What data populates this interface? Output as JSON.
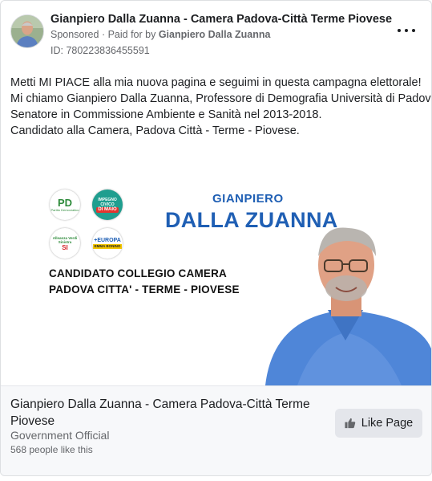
{
  "post": {
    "page_name": "Gianpiero Dalla Zuanna - Camera Padova-Città Terme Piovese",
    "sponsored_label": "Sponsored",
    "paid_for_text": "Paid for by",
    "paid_for_name": "Gianpiero Dalla Zuanna",
    "ad_id": "ID: 780223836455591",
    "more_icon": "more-horizontal-icon",
    "body_lines": [
      "Metti MI PIACE alla mia nuova pagina e seguimi in questa campagna elettorale!",
      "Mi chiamo Gianpiero Dalla Zuanna, Professore di Demografia Università di Padova,",
      "Senatore in Commissione Ambiente e Sanità nel 2013-2018.",
      "Candidato alla Camera, Padova Città - Terme - Piovese."
    ]
  },
  "creative": {
    "first_name": "GIANPIERO",
    "last_name": "DALLA ZUANNA",
    "candidate_line1": "CANDIDATO COLLEGIO CAMERA",
    "candidate_line2": "PADOVA CITTA' - TERME - PIOVESE",
    "logos": {
      "pd": {
        "main": "PD",
        "sub": "Partito Democratico"
      },
      "ic": {
        "top": "IMPEGNO CIVICO",
        "bottom": "DI MAIO"
      },
      "avs": {
        "top": "Alleanza Verdi Sinistra",
        "bottom": "SI"
      },
      "europa": {
        "top": "+EUROPA",
        "bottom": "EMMA BONINO"
      }
    },
    "colors": {
      "headline": "#1f5fb4",
      "pd_green": "#2e8b3b",
      "pd_red": "#d7262b"
    }
  },
  "footer": {
    "title": "Gianpiero Dalla Zuanna - Camera Padova-Città Terme Piovese",
    "category": "Government Official",
    "likes": "568 people like this",
    "like_button": "Like Page",
    "like_icon": "thumbs-up-icon"
  }
}
